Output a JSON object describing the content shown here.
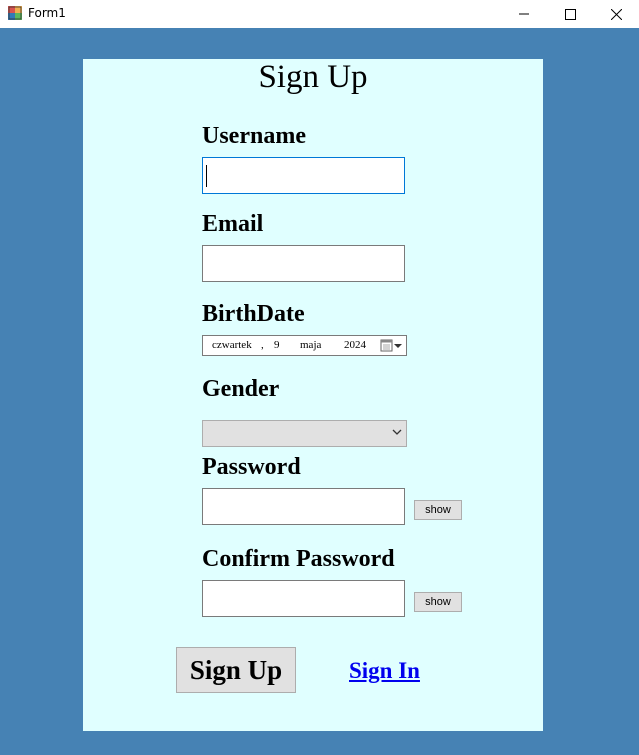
{
  "window": {
    "title": "Form1",
    "icon": "winforms-app-icon"
  },
  "form": {
    "title": "Sign Up",
    "username": {
      "label": "Username",
      "value": ""
    },
    "email": {
      "label": "Email",
      "value": ""
    },
    "birthdate": {
      "label": "BirthDate",
      "weekday": "czwartek",
      "separator": ",",
      "day": "9",
      "month": "maja",
      "year": "2024",
      "icon": "calendar-dropdown-icon"
    },
    "gender": {
      "label": "Gender",
      "selected": ""
    },
    "password": {
      "label": "Password",
      "value": "",
      "show_label": "show"
    },
    "confirm_password": {
      "label": "Confirm Password",
      "value": "",
      "show_label": "show"
    },
    "signup_button": "Sign Up",
    "signin_link": "Sign In"
  },
  "colors": {
    "background": "#4682b4",
    "panel": "#e0ffff",
    "link": "#0000ee",
    "button_face": "#e1e1e1",
    "focus_border": "#0078d7"
  }
}
